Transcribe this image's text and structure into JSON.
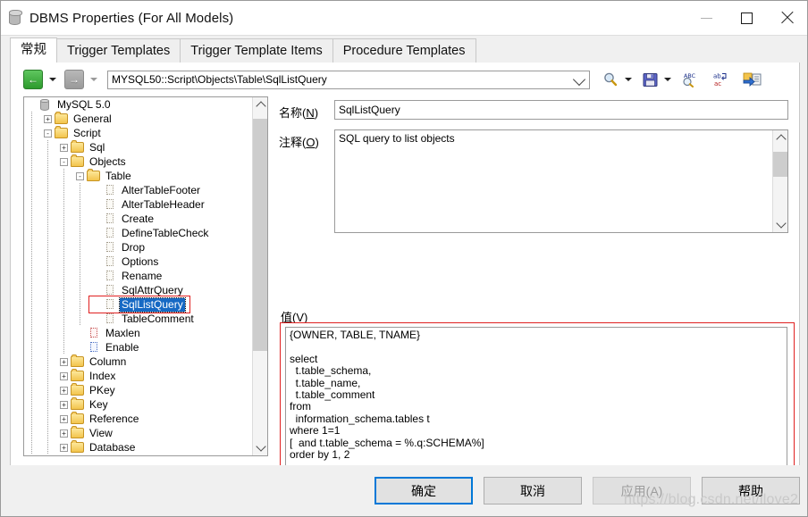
{
  "window": {
    "title": "DBMS Properties (For All Models)",
    "icon": "database-cylinder-icon",
    "controls": {
      "minimize": "—",
      "maximize": "□",
      "close": "✕"
    }
  },
  "tabs": [
    {
      "label": "常规",
      "active": true
    },
    {
      "label": "Trigger Templates",
      "active": false
    },
    {
      "label": "Trigger Template Items",
      "active": false
    },
    {
      "label": "Procedure Templates",
      "active": false
    }
  ],
  "toolbar": {
    "back_tooltip": "Back",
    "forward_tooltip": "Forward",
    "path_value": "MYSQL50::Script\\Objects\\Table\\SqlListQuery",
    "icons": [
      "find-icon",
      "save-icon",
      "spellcheck-icon",
      "find-replace-icon",
      "export-icon"
    ]
  },
  "tree": {
    "items": [
      {
        "label": "MySQL 5.0",
        "depth": 0,
        "toggle": "",
        "icon": "database-icon"
      },
      {
        "label": "General",
        "depth": 1,
        "toggle": "+",
        "icon": "folder-icon"
      },
      {
        "label": "Script",
        "depth": 1,
        "toggle": "-",
        "icon": "folder-icon"
      },
      {
        "label": "Sql",
        "depth": 2,
        "toggle": "+",
        "icon": "folder-icon"
      },
      {
        "label": "Objects",
        "depth": 2,
        "toggle": "-",
        "icon": "folder-icon"
      },
      {
        "label": "Table",
        "depth": 3,
        "toggle": "-",
        "icon": "folder-icon"
      },
      {
        "label": "AlterTableFooter",
        "depth": 4,
        "toggle": "",
        "icon": "script-icon"
      },
      {
        "label": "AlterTableHeader",
        "depth": 4,
        "toggle": "",
        "icon": "script-icon"
      },
      {
        "label": "Create",
        "depth": 4,
        "toggle": "",
        "icon": "script-icon"
      },
      {
        "label": "DefineTableCheck",
        "depth": 4,
        "toggle": "",
        "icon": "script-icon"
      },
      {
        "label": "Drop",
        "depth": 4,
        "toggle": "",
        "icon": "script-icon"
      },
      {
        "label": "Options",
        "depth": 4,
        "toggle": "",
        "icon": "script-icon"
      },
      {
        "label": "Rename",
        "depth": 4,
        "toggle": "",
        "icon": "script-icon"
      },
      {
        "label": "SqlAttrQuery",
        "depth": 4,
        "toggle": "",
        "icon": "script-icon"
      },
      {
        "label": "SqlListQuery",
        "depth": 4,
        "toggle": "",
        "icon": "script-icon",
        "selected": true,
        "annotated": true
      },
      {
        "label": "TableComment",
        "depth": 4,
        "toggle": "",
        "icon": "script-icon"
      },
      {
        "label": "Maxlen",
        "depth": 3,
        "toggle": "",
        "icon": "value-red-icon"
      },
      {
        "label": "Enable",
        "depth": 3,
        "toggle": "",
        "icon": "value-blue-icon"
      },
      {
        "label": "Column",
        "depth": 2,
        "toggle": "+",
        "icon": "folder-icon"
      },
      {
        "label": "Index",
        "depth": 2,
        "toggle": "+",
        "icon": "folder-icon"
      },
      {
        "label": "PKey",
        "depth": 2,
        "toggle": "+",
        "icon": "folder-icon"
      },
      {
        "label": "Key",
        "depth": 2,
        "toggle": "+",
        "icon": "folder-icon"
      },
      {
        "label": "Reference",
        "depth": 2,
        "toggle": "+",
        "icon": "folder-icon"
      },
      {
        "label": "View",
        "depth": 2,
        "toggle": "+",
        "icon": "folder-icon"
      },
      {
        "label": "Database",
        "depth": 2,
        "toggle": "+",
        "icon": "folder-icon"
      }
    ]
  },
  "form": {
    "name_label": "名称(N)",
    "name_value": "SqlListQuery",
    "comment_label": "注释(O)",
    "comment_value": "SQL query to list objects",
    "value_label": "值(V)",
    "value_code": "{OWNER, TABLE, TNAME}\n\nselect\n  t.table_schema,\n  t.table_name,\n  t.table_comment\nfrom\n  information_schema.tables t\nwhere 1=1\n[  and t.table_schema = %.q:SCHEMA%]\norder by 1, 2"
  },
  "footer": {
    "ok": "确定",
    "cancel": "取消",
    "apply": "应用(A)",
    "help": "帮助"
  },
  "watermark": "https://blog.csdn.net/ilove2",
  "colors": {
    "accent": "#0078d7",
    "selection": "#1669c4",
    "annotation": "#e02020",
    "folder": "#f3c44c"
  }
}
